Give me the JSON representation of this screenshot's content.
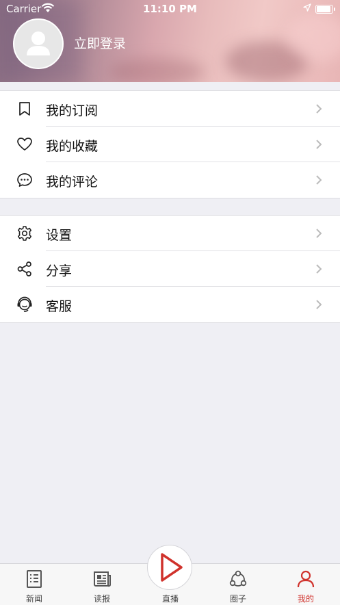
{
  "status_bar": {
    "carrier": "Carrier",
    "time": "11:10 PM"
  },
  "profile": {
    "login_label": "立即登录"
  },
  "menu_group_1": [
    {
      "label": "我的订阅",
      "icon": "bookmark-icon"
    },
    {
      "label": "我的收藏",
      "icon": "heart-icon"
    },
    {
      "label": "我的评论",
      "icon": "comment-icon"
    }
  ],
  "menu_group_2": [
    {
      "label": "设置",
      "icon": "gear-icon"
    },
    {
      "label": "分享",
      "icon": "share-icon"
    },
    {
      "label": "客服",
      "icon": "headset-icon"
    }
  ],
  "tabbar": {
    "items": [
      {
        "label": "新闻",
        "icon": "news-list-icon"
      },
      {
        "label": "读报",
        "icon": "newspaper-icon"
      },
      {
        "label": "直播",
        "icon": "play-icon"
      },
      {
        "label": "圈子",
        "icon": "circle-group-icon"
      },
      {
        "label": "我的",
        "icon": "person-icon"
      }
    ],
    "active": "我的"
  },
  "colors": {
    "accent": "#d0322c",
    "background": "#efeff4"
  }
}
